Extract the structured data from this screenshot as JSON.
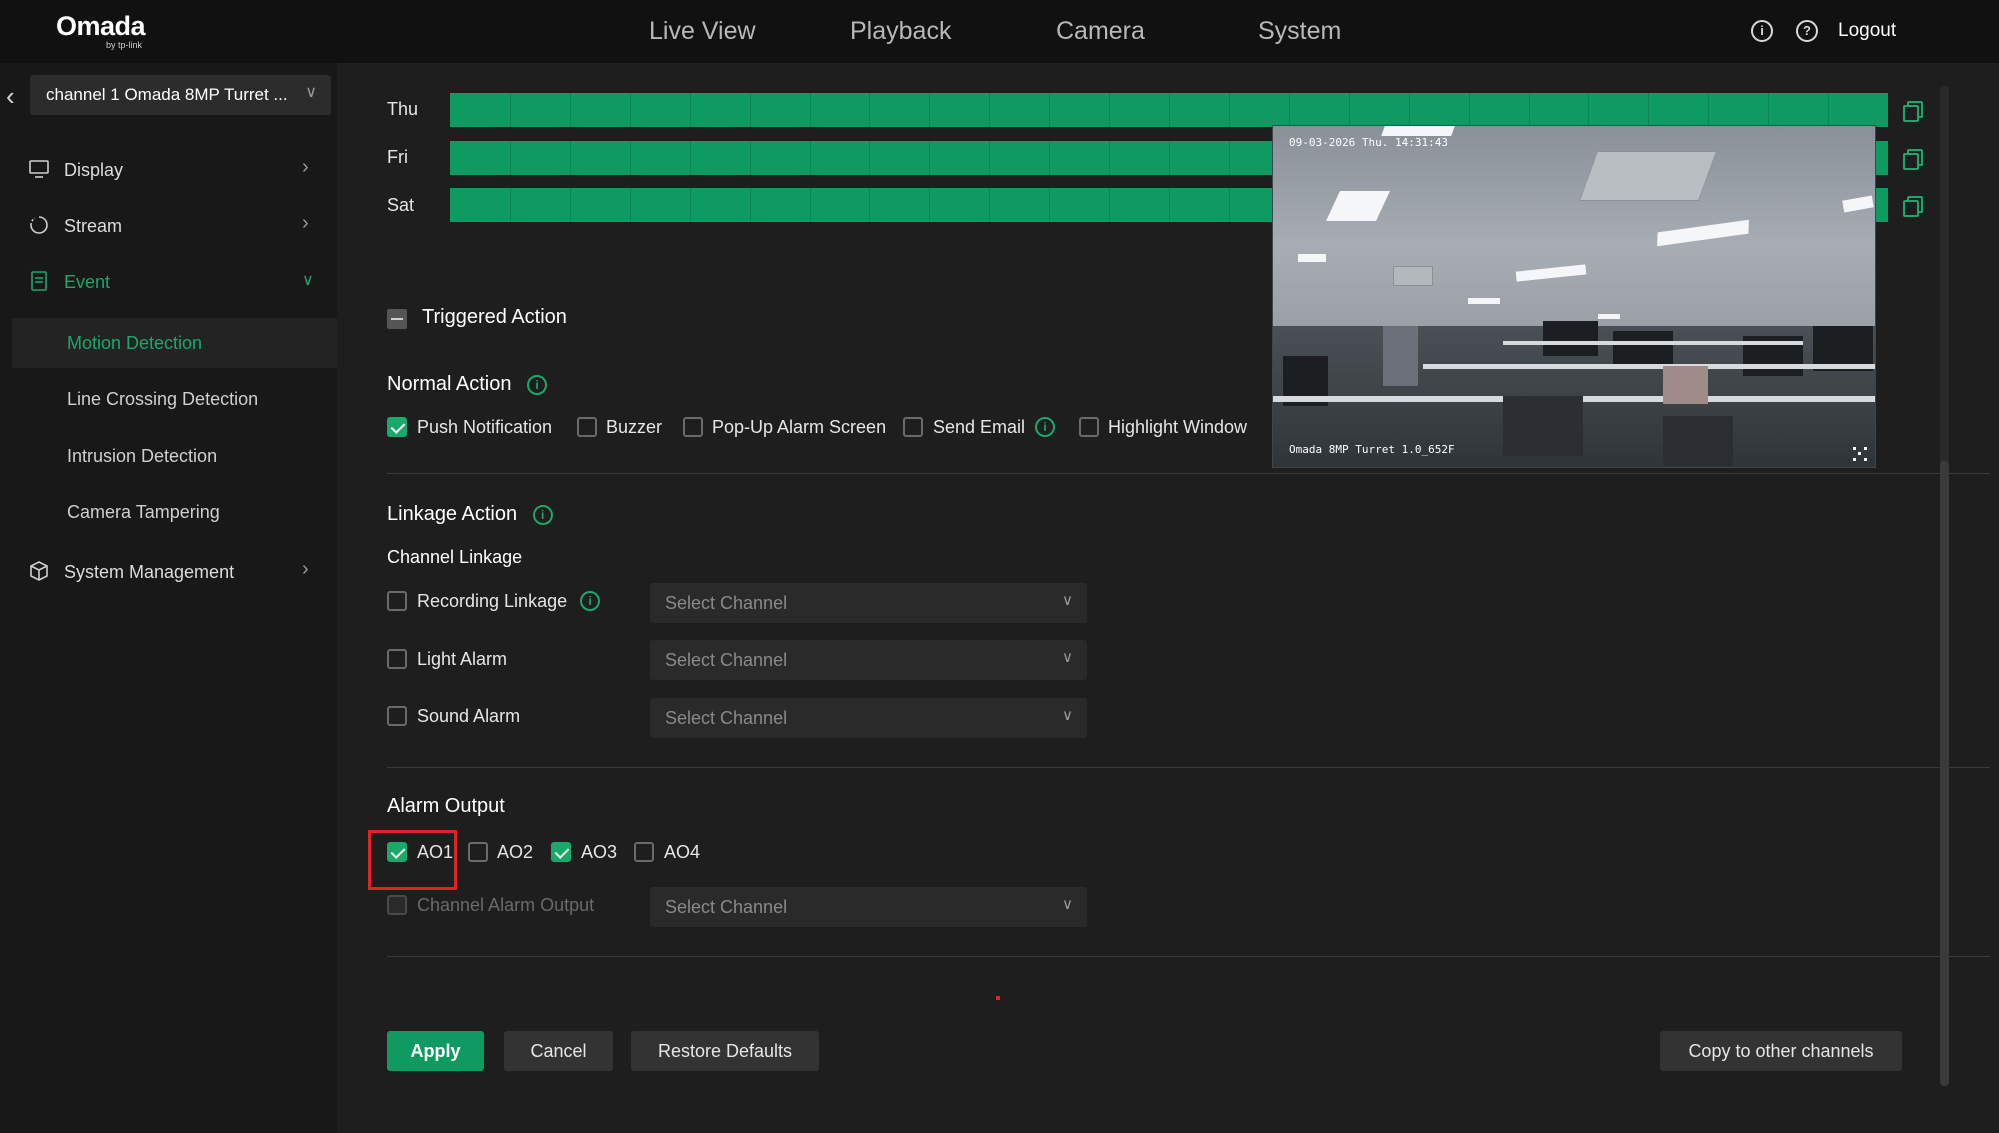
{
  "header": {
    "brand": "Omada",
    "brand_sub": "by tp-link",
    "tabs": [
      "Live View",
      "Playback",
      "Camera",
      "System"
    ],
    "logout_label": "Logout"
  },
  "sidebar": {
    "channel_select": "channel 1 Omada 8MP Turret ...",
    "items": [
      {
        "label": "Display",
        "icon": "monitor-icon"
      },
      {
        "label": "Stream",
        "icon": "stream-icon"
      },
      {
        "label": "Event",
        "icon": "event-icon"
      },
      {
        "label": "System Management",
        "icon": "cube-icon"
      }
    ],
    "event_subitems": [
      "Motion Detection",
      "Line Crossing Detection",
      "Intrusion Detection",
      "Camera Tampering"
    ]
  },
  "schedule": {
    "days": [
      "Thu",
      "Fri",
      "Sat"
    ]
  },
  "triggered_action": {
    "title": "Triggered Action",
    "normal_action": {
      "title": "Normal Action",
      "options": [
        {
          "label": "Push Notification",
          "checked": true
        },
        {
          "label": "Buzzer",
          "checked": false
        },
        {
          "label": "Pop-Up Alarm Screen",
          "checked": false
        },
        {
          "label": "Send Email",
          "checked": false
        },
        {
          "label": "Highlight Window",
          "checked": false
        }
      ]
    },
    "linkage_action": {
      "title": "Linkage Action",
      "channel_linkage": "Channel Linkage",
      "rows": [
        {
          "label": "Recording Linkage",
          "checked": false,
          "placeholder": "Select Channel"
        },
        {
          "label": "Light Alarm",
          "checked": false,
          "placeholder": "Select Channel"
        },
        {
          "label": "Sound Alarm",
          "checked": false,
          "placeholder": "Select Channel"
        }
      ]
    },
    "alarm_output": {
      "title": "Alarm Output",
      "outputs": [
        {
          "label": "AO1",
          "checked": true
        },
        {
          "label": "AO2",
          "checked": false
        },
        {
          "label": "AO3",
          "checked": true
        },
        {
          "label": "AO4",
          "checked": false
        }
      ],
      "channel_alarm_output": {
        "label": "Channel Alarm Output",
        "placeholder": "Select Channel"
      }
    }
  },
  "buttons": {
    "apply": "Apply",
    "cancel": "Cancel",
    "restore": "Restore Defaults",
    "copy": "Copy to other channels"
  },
  "preview": {
    "timestamp": "09-03-2026 Thu. 14:31:43",
    "camera_name": "Omada 8MP Turret 1.0_652F"
  },
  "colors": {
    "accent": "#1aa86b",
    "schedule_bar": "#0f9a61",
    "highlight": "#e02424"
  }
}
